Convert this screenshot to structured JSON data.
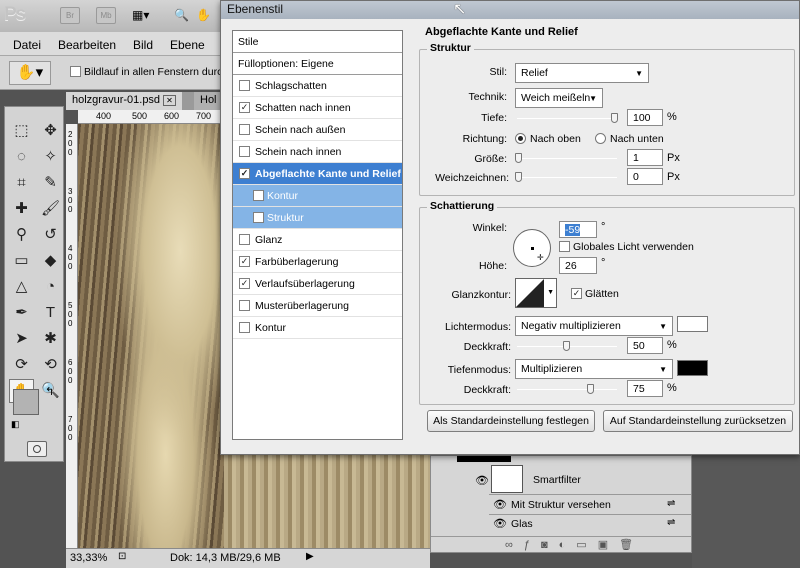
{
  "app": {
    "logo": "Ps",
    "bridge_btn": "Br",
    "mini_btn": "Mb"
  },
  "menu": [
    "Datei",
    "Bearbeiten",
    "Bild",
    "Ebene"
  ],
  "options": {
    "scroll_all": "Bildlauf in allen Fenstern durch"
  },
  "doc": {
    "tab1": "holzgravur-01.psd",
    "tab2": "Hol",
    "ruler_h": [
      "400",
      "500",
      "600",
      "700"
    ],
    "ruler_v": [
      "2",
      "0",
      "0",
      "3",
      "0",
      "0",
      "4",
      "0",
      "0",
      "5",
      "0",
      "0",
      "6",
      "0",
      "0",
      "7",
      "0",
      "0"
    ],
    "zoom": "33,33%",
    "info": "Dok: 14,3 MB/29,6 MB"
  },
  "dialog": {
    "title": "Ebenenstil",
    "list_head": "Stile",
    "fill_options": "Fülloptionen: Eigene",
    "styles": [
      {
        "label": "Schlagschatten",
        "checked": false
      },
      {
        "label": "Schatten nach innen",
        "checked": true
      },
      {
        "label": "Schein nach außen",
        "checked": false
      },
      {
        "label": "Schein nach innen",
        "checked": false
      },
      {
        "label": "Abgeflachte Kante und Relief",
        "checked": true
      },
      {
        "label": "Kontur",
        "checked": false
      },
      {
        "label": "Struktur",
        "checked": false
      },
      {
        "label": "Glanz",
        "checked": false
      },
      {
        "label": "Farbüberlagerung",
        "checked": true
      },
      {
        "label": "Verlaufsüberlagerung",
        "checked": true
      },
      {
        "label": "Musterüberlagerung",
        "checked": false
      },
      {
        "label": "Kontur",
        "checked": false
      }
    ],
    "section_title": "Abgeflachte Kante und Relief",
    "struktur": {
      "title": "Struktur",
      "style_label": "Stil:",
      "style_value": "Relief",
      "technique_label": "Technik:",
      "technique_value": "Weich meißeln",
      "depth_label": "Tiefe:",
      "depth_value": "100",
      "depth_unit": "%",
      "depth_frac": 1.0,
      "direction_label": "Richtung:",
      "dir_up": "Nach oben",
      "dir_down": "Nach unten",
      "size_label": "Größe:",
      "size_value": "1",
      "size_unit": "Px",
      "size_frac": 0.0,
      "soften_label": "Weichzeichnen:",
      "soften_value": "0",
      "soften_unit": "Px",
      "soften_frac": 0.0
    },
    "schattierung": {
      "title": "Schattierung",
      "angle_label": "Winkel:",
      "angle_value": "-59",
      "angle_unit": "°",
      "global_light": "Globales Licht verwenden",
      "height_label": "Höhe:",
      "height_value": "26",
      "height_unit": "°",
      "gloss_label": "Glanzkontur:",
      "smooth": "Glätten",
      "highlight_label": "Lichtermodus:",
      "highlight_value": "Negativ multiplizieren",
      "highlight_color": "#ffffff",
      "opacity1_label": "Deckkraft:",
      "opacity1_value": "50",
      "opacity1_unit": "%",
      "opacity1_frac": 0.5,
      "shadow_label": "Tiefenmodus:",
      "shadow_value": "Multiplizieren",
      "shadow_color": "#000000",
      "opacity2_label": "Deckkraft:",
      "opacity2_value": "75",
      "opacity2_unit": "%",
      "opacity2_frac": 0.75
    },
    "btn_default_set": "Als Standardeinstellung festlegen",
    "btn_default_reset": "Auf Standardeinstellung zurücksetzen"
  },
  "layers": {
    "smartfilter": "Smartfilter",
    "filter1": "Mit Struktur versehen",
    "filter2": "Glas"
  }
}
